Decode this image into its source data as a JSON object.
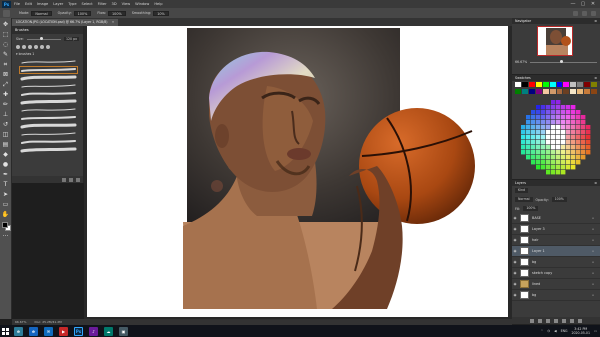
{
  "app": {
    "logo": "Ps",
    "menu": [
      "File",
      "Edit",
      "Image",
      "Layer",
      "Type",
      "Select",
      "Filter",
      "3D",
      "View",
      "Window",
      "Help"
    ],
    "window_controls": [
      "—",
      "▢",
      "✕"
    ]
  },
  "options": {
    "mode_label": "Mode:",
    "mode_value": "Normal",
    "opacity_label": "Opacity:",
    "opacity_value": "100%",
    "flow_label": "Flow:",
    "flow_value": "100%",
    "smoothing_label": "Smoothing:",
    "smoothing_value": "10%"
  },
  "document": {
    "tab_title": "LOCATION.JPG (LOCATION.psd) @ 66.7% (Layer 1, RGB/8)",
    "tab_close": "✕",
    "status_zoom": "66.67%",
    "status_doc": "Doc: 25.2M/41.2M"
  },
  "brush_panel": {
    "title": "Brushes",
    "size_label": "Size:",
    "size_value": "120 px",
    "folder_name": "brushes 1",
    "strokes": 12
  },
  "navigator": {
    "title": "Navigator",
    "zoom_value": "66.67%"
  },
  "swatches": {
    "title": "Swatches",
    "colors": [
      "#ffffff",
      "#000000",
      "#ff0000",
      "#ffff00",
      "#00ff00",
      "#00ffff",
      "#0000ff",
      "#ff00ff",
      "#c0c0c0",
      "#808080",
      "#800000",
      "#808000",
      "#008000",
      "#008080",
      "#000080",
      "#800080",
      "#f4c7a1",
      "#d29a6b",
      "#a86a3f",
      "#6b3f22",
      "#f5e6c8",
      "#e9b97a",
      "#c77b3a",
      "#8b4513"
    ],
    "wheel_cells": 16
  },
  "layers": {
    "title": "Layers",
    "kind_label": "Kind",
    "blend_mode": "Normal",
    "opacity_label": "Opacity:",
    "opacity_value": "100%",
    "fill_label": "Fill:",
    "fill_value": "100%",
    "items": [
      {
        "name": "BASE",
        "active": false,
        "group": false
      },
      {
        "name": "Layer 3",
        "active": false,
        "group": false
      },
      {
        "name": "hair",
        "active": false,
        "group": false
      },
      {
        "name": "Layer 1",
        "active": true,
        "group": false
      },
      {
        "name": "bg",
        "active": false,
        "group": false
      },
      {
        "name": "sketch copy",
        "active": false,
        "group": false
      },
      {
        "name": "lined",
        "active": false,
        "group": true
      },
      {
        "name": "bg",
        "active": false,
        "group": false
      }
    ]
  },
  "taskbar": {
    "apps": [
      "e",
      "e",
      "✉",
      "▶",
      "Ps",
      "♪",
      "☁",
      "▣"
    ],
    "lang": "ENG",
    "time": "3:42 PM",
    "date": "2020-05-01"
  },
  "colors": {
    "accent": "#31a8ff",
    "panel": "#3b3b3b",
    "active_layer": "#4f5a66"
  }
}
